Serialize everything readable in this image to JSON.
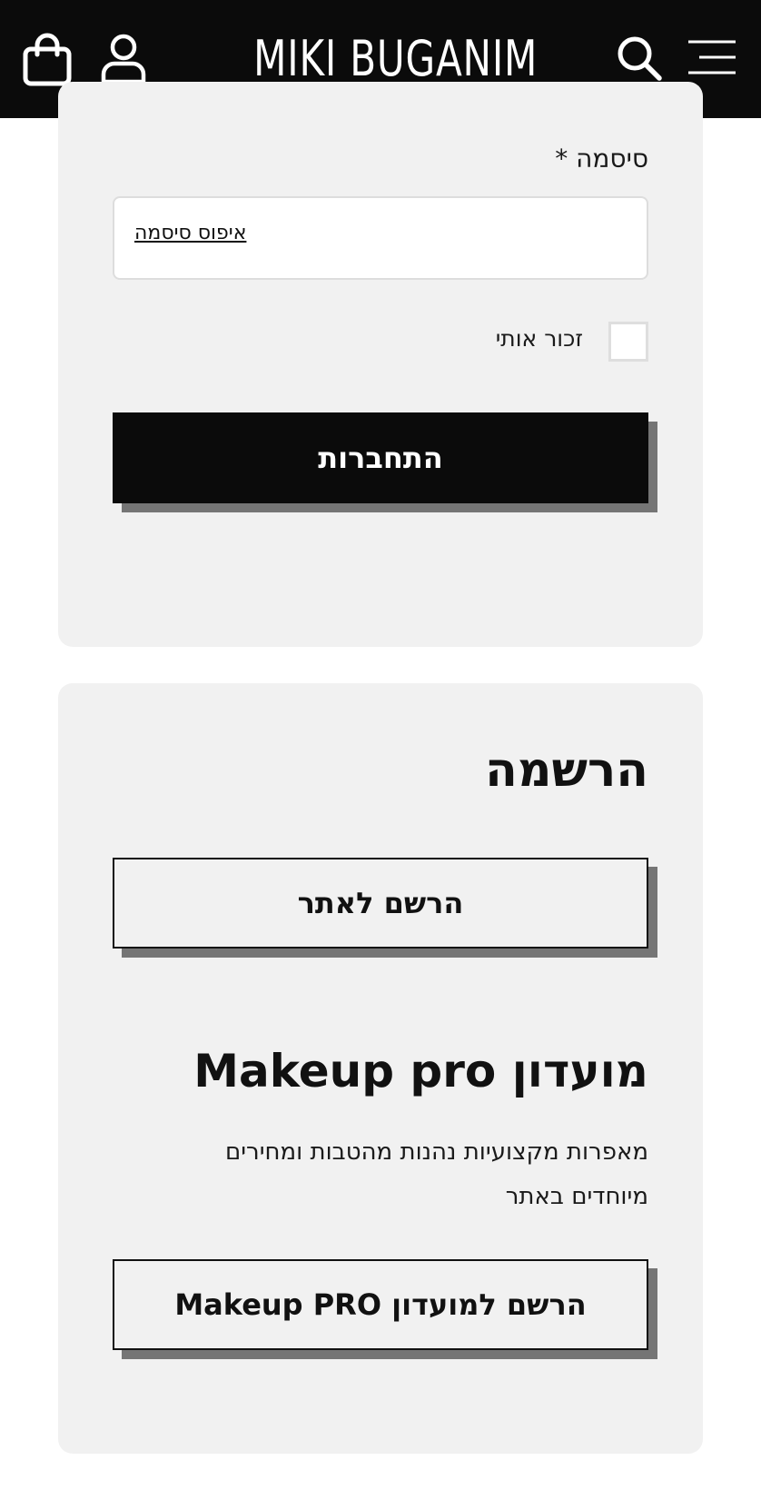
{
  "header": {
    "logo": "MIKI BUGANIM",
    "icons": [
      "bag-icon",
      "user-icon",
      "search-icon",
      "menu-icon"
    ]
  },
  "login": {
    "password_label": "סיסמה *",
    "reset_password_link": "איפוס סיסמה",
    "remember_me_label": "זכור אותי",
    "remember_me_checked": false,
    "login_button": "התחברות"
  },
  "register": {
    "heading": "הרשמה",
    "register_button": "הרשם לאתר",
    "club_heading": "מועדון Makeup pro",
    "club_description": "מאפרות מקצועיות נהנות מהטבות ומחירים מיוחדים באתר",
    "club_button": "הרשם למועדון Makeup PRO"
  },
  "colors": {
    "header_bg": "#0b0b0b",
    "card_bg": "#f1f1f1",
    "button_shadow": "#757575",
    "text": "#111111"
  }
}
